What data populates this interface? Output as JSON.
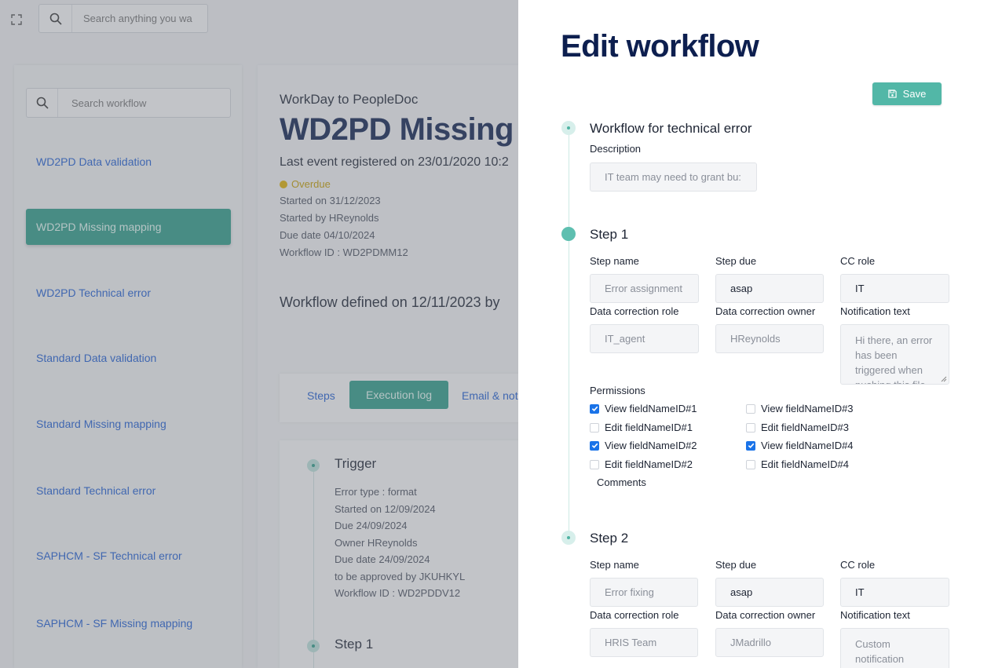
{
  "topbar": {
    "search_placeholder": "Search anything you wa"
  },
  "sidebar": {
    "search_placeholder": "Search workflow",
    "items": [
      {
        "label": "WD2PD Data validation",
        "active": false
      },
      {
        "label": "WD2PD Missing mapping",
        "active": true
      },
      {
        "label": "WD2PD Technical error",
        "active": false
      },
      {
        "label": "Standard Data validation",
        "active": false
      },
      {
        "label": "Standard Missing mapping",
        "active": false
      },
      {
        "label": "Standard Technical error",
        "active": false
      },
      {
        "label": "SAPHCM - SF Technical error",
        "active": false
      },
      {
        "label": "SAPHCM - SF Missing mapping",
        "active": false
      }
    ]
  },
  "main": {
    "subtitle": "WorkDay to PeopleDoc",
    "title": "WD2PD Missing",
    "last_event": "Last event registered on 23/01/2020 10:2",
    "status": "Overdue",
    "started_on": "Started on 31/12/2023",
    "started_by": "Started by HReynolds",
    "due_date": "Due date 04/10/2024",
    "workflow_id": "Workflow ID : WD2PDMM12",
    "workflow_defined": "Workflow defined on 12/11/2023 by",
    "tabs": [
      {
        "label": "Steps",
        "active": false
      },
      {
        "label": "Execution log",
        "active": true
      },
      {
        "label": "Email & noti",
        "active": false
      }
    ],
    "log": {
      "trigger_title": "Trigger",
      "trigger_lines": [
        "Error type : format",
        "Started on 12/09/2024",
        "Due 24/09/2024",
        "Owner HReynolds",
        "Due date 24/09/2024",
        "to be approved by JKUHKYL",
        "Workflow ID : WD2PDDV12"
      ],
      "step1_title": "Step 1"
    }
  },
  "drawer": {
    "title": "Edit workflow",
    "save_label": "Save",
    "workflow": {
      "title": "Workflow for technical error",
      "description_label": "Description",
      "description_value": "IT team may need to grant bu:"
    },
    "step1": {
      "title": "Step 1",
      "step_name_label": "Step name",
      "step_name_placeholder": "Error assignment",
      "step_due_label": "Step due",
      "step_due_value": "asap",
      "cc_role_label": "CC role",
      "cc_role_value": "IT",
      "dc_role_label": "Data correction role",
      "dc_role_placeholder": "IT_agent",
      "dc_owner_label": "Data correction owner",
      "dc_owner_placeholder": "HReynolds",
      "notif_label": "Notification text",
      "notif_placeholder": "Hi there, an error has been triggered when pushing this file",
      "permissions_label": "Permissions",
      "permissions": [
        {
          "label": "View fieldNameID#1",
          "checked": true
        },
        {
          "label": "Edit fieldNameID#1",
          "checked": false
        },
        {
          "label": "View fieldNameID#2",
          "checked": true
        },
        {
          "label": "Edit fieldNameID#2",
          "checked": false
        },
        {
          "label": "View fieldNameID#3",
          "checked": false
        },
        {
          "label": "Edit fieldNameID#3",
          "checked": false
        },
        {
          "label": "View fieldNameID#4",
          "checked": true
        },
        {
          "label": "Edit fieldNameID#4",
          "checked": false
        }
      ],
      "comments_label": "Comments"
    },
    "step2": {
      "title": "Step 2",
      "step_name_label": "Step name",
      "step_name_placeholder": "Error fixing",
      "step_due_label": "Step due",
      "step_due_value": "asap",
      "cc_role_label": "CC role",
      "cc_role_value": "IT",
      "dc_role_label": "Data correction role",
      "dc_role_placeholder": "HRIS Team",
      "dc_owner_label": "Data correction owner",
      "dc_owner_placeholder": "JMadrillo",
      "notif_label": "Notification text",
      "notif_placeholder": "Custom notification"
    }
  }
}
